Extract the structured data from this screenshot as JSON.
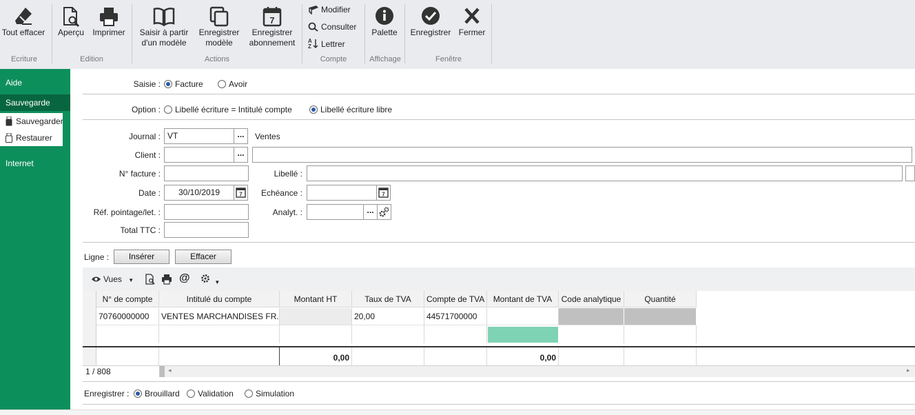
{
  "ribbon": {
    "ecriture": {
      "tout_effacer": "Tout effacer",
      "group": "Ecriture"
    },
    "edition": {
      "apercu": "Aperçu",
      "imprimer": "Imprimer",
      "group": "Edition"
    },
    "actions": {
      "saisir_l1": "Saisir à partir",
      "saisir_l2": "d'un modèle",
      "enreg_modele_l1": "Enregistrer",
      "enreg_modele_l2": "modèle",
      "enreg_abon_l1": "Enregistrer",
      "enreg_abon_l2": "abonnement",
      "calendar_day": "7",
      "group": "Actions"
    },
    "compte": {
      "modifier": "Modifier",
      "consulter": "Consulter",
      "lettrer": "Lettrer",
      "group": "Compte"
    },
    "affichage": {
      "palette": "Palette",
      "group": "Affichage"
    },
    "fenetre": {
      "enregistrer": "Enregistrer",
      "fermer": "Fermer",
      "group": "Fenêtre"
    }
  },
  "sidebar": {
    "aide": "Aide",
    "sauvegarde": "Sauvegarde",
    "sauvegarder": "Sauvegarder",
    "restaurer": "Restaurer",
    "internet": "Internet"
  },
  "form": {
    "saisie_label": "Saisie :",
    "facture": "Facture",
    "avoir": "Avoir",
    "option_label": "Option :",
    "option_intitule": "Libellé écriture = Intitulé compte",
    "option_libre": "Libellé écriture libre",
    "journal_label": "Journal :",
    "journal_value": "VT",
    "journal_name": "Ventes",
    "client_label": "Client :",
    "client_value": "",
    "client_name": "",
    "nfacture_label": "N° facture :",
    "nfacture_value": "",
    "libelle_label": "Libellé :",
    "libelle_value": "",
    "date_label": "Date :",
    "date_value": "30/10/2019",
    "echeance_label": "Echéance :",
    "echeance_value": "",
    "ref_label": "Réf. pointage/let. :",
    "ref_value": "",
    "analyt_label": "Analyt. :",
    "analyt_value": "",
    "total_label": "Total TTC :",
    "total_value": "",
    "ligne_label": "Ligne :",
    "inserer": "Insérer",
    "effacer": "Effacer"
  },
  "grid": {
    "vues": "Vues",
    "columns": [
      "N° de compte",
      "Intitulé du compte",
      "Montant HT",
      "Taux de TVA",
      "Compte de TVA",
      "Montant de TVA",
      "Code analytique",
      "Quantité"
    ],
    "rows": [
      [
        "70760000000",
        "VENTES MARCHANDISES FR.",
        "",
        "20,00",
        "44571700000",
        "",
        "",
        ""
      ]
    ],
    "totals": {
      "montant_ht": "0,00",
      "montant_tva": "0,00"
    },
    "pager": "1 / 808"
  },
  "enregistrer": {
    "label": "Enregistrer :",
    "brouillard": "Brouillard",
    "validation": "Validation",
    "simulation": "Simulation"
  },
  "colors": {
    "sidebar": "#0d8f5c",
    "sidebar_active": "#07663f",
    "ribbon": "#e9ebee",
    "grid_highlight": "#7fd3b5",
    "grid_grey": "#c0c0c0"
  }
}
